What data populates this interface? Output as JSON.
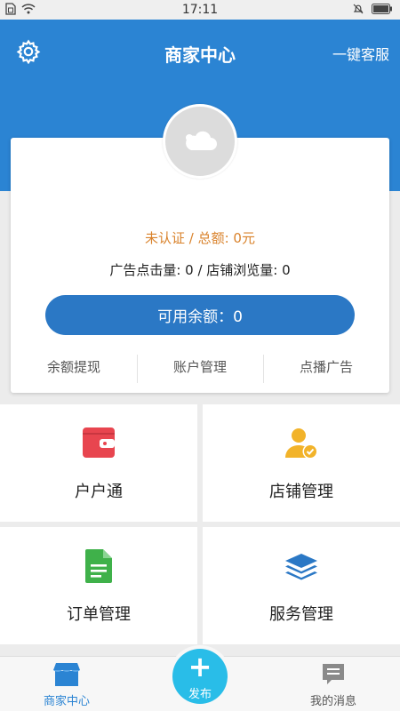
{
  "status_bar": {
    "time": "17:11"
  },
  "header": {
    "title": "商家中心",
    "service_label": "一键客服"
  },
  "card": {
    "status_text": "未认证 / 总额: 0元",
    "stats_text": "广告点击量: 0 / 店铺浏览量: 0",
    "balance_label": "可用余额：0",
    "actions": [
      "余额提现",
      "账户管理",
      "点播广告"
    ]
  },
  "tiles": [
    {
      "label": "户户通",
      "icon": "wallet-icon",
      "color": "#e8454f"
    },
    {
      "label": "店铺管理",
      "icon": "user-check-icon",
      "color": "#f2b32a"
    },
    {
      "label": "订单管理",
      "icon": "document-icon",
      "color": "#3fb14a"
    },
    {
      "label": "服务管理",
      "icon": "layers-icon",
      "color": "#2b78c5"
    }
  ],
  "bottom_nav": {
    "home_label": "商家中心",
    "publish_label": "发布",
    "messages_label": "我的消息"
  },
  "colors": {
    "primary": "#2b84d3",
    "accent_orange": "#d9822b",
    "publish": "#29bde8"
  }
}
